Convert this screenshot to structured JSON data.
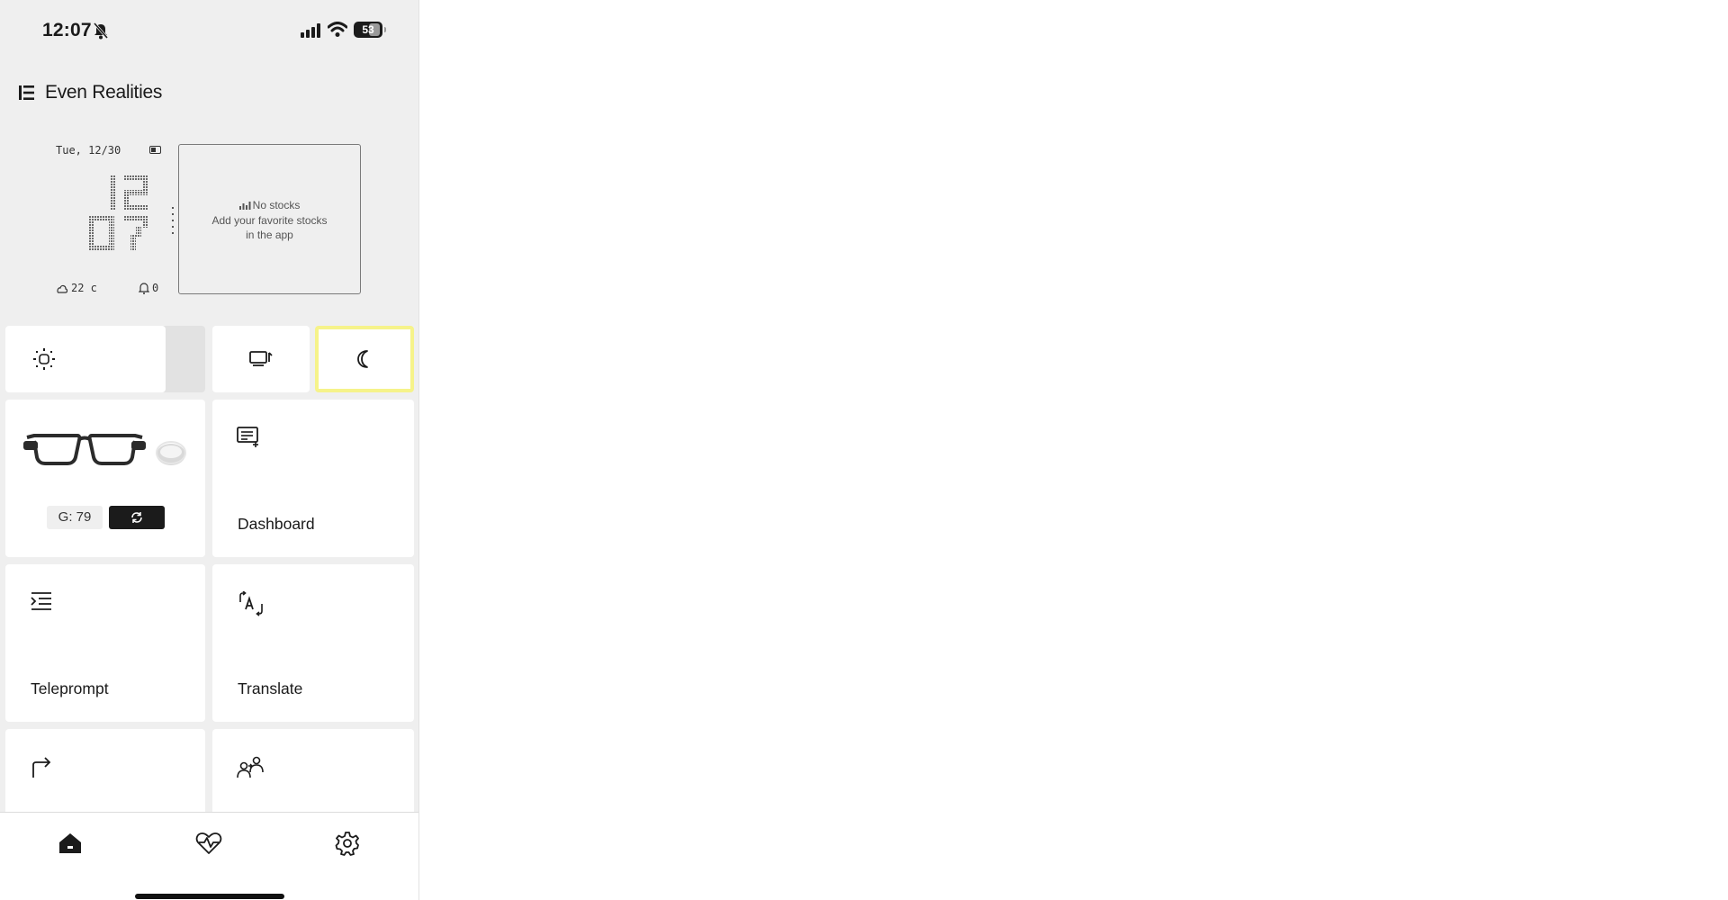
{
  "status_bar": {
    "time": "12:07",
    "battery": "53",
    "icons": [
      "bell-off-icon",
      "signal-icon",
      "wifi-icon",
      "battery-icon"
    ]
  },
  "header": {
    "title": "Even Realities",
    "menu_icon": "list-icon"
  },
  "hud": {
    "date": "Tue, 12/30",
    "clock_hour": "12",
    "clock_minute": "07",
    "weather": "22 c",
    "notifications": "0"
  },
  "stocks": {
    "title": "No stocks",
    "line1": "Add your favorite stocks",
    "line2": "in the app"
  },
  "quick_controls": {
    "brightness_level": 0.8,
    "brightness_icon": "sun-icon",
    "display_icon": "display-icon",
    "night_icon": "moon-icon",
    "accent": "#f6f38a"
  },
  "device": {
    "glasses_battery": "G: 79",
    "sync_icon": "sync-icon"
  },
  "features": {
    "dashboard": "Dashboard",
    "teleprompt": "Teleprompt",
    "translate": "Translate"
  },
  "tabbar": {
    "items": [
      "home-icon",
      "heart-pulse-icon",
      "settings-gear-icon"
    ]
  }
}
